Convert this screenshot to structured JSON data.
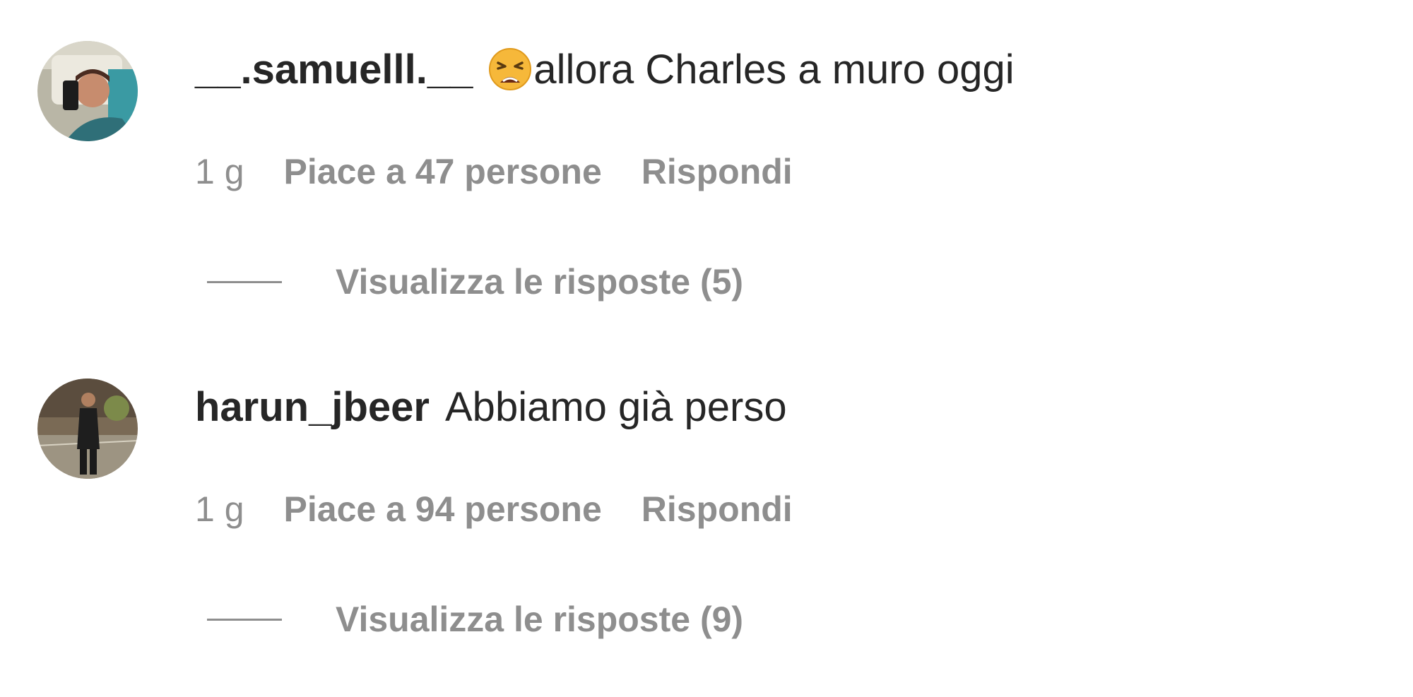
{
  "comments": [
    {
      "username": "__.samuelll.__",
      "emoji": "weary-face-emoji",
      "text": "allora Charles a muro oggi",
      "time": "1 g",
      "likes": "Piace a 47 persone",
      "reply_label": "Rispondi",
      "view_replies_label": "Visualizza le risposte (5)",
      "avatar_icon": "user-avatar-selfie-car"
    },
    {
      "username": "harun_jbeer",
      "text": "Abbiamo già perso",
      "time": "1 g",
      "likes": "Piace a 94 persone",
      "reply_label": "Rispondi",
      "view_replies_label": "Visualizza le risposte (9)",
      "avatar_icon": "user-avatar-street-night"
    }
  ],
  "colors": {
    "primary_text": "#262626",
    "secondary_text": "#8e8e8e",
    "background": "#ffffff"
  }
}
